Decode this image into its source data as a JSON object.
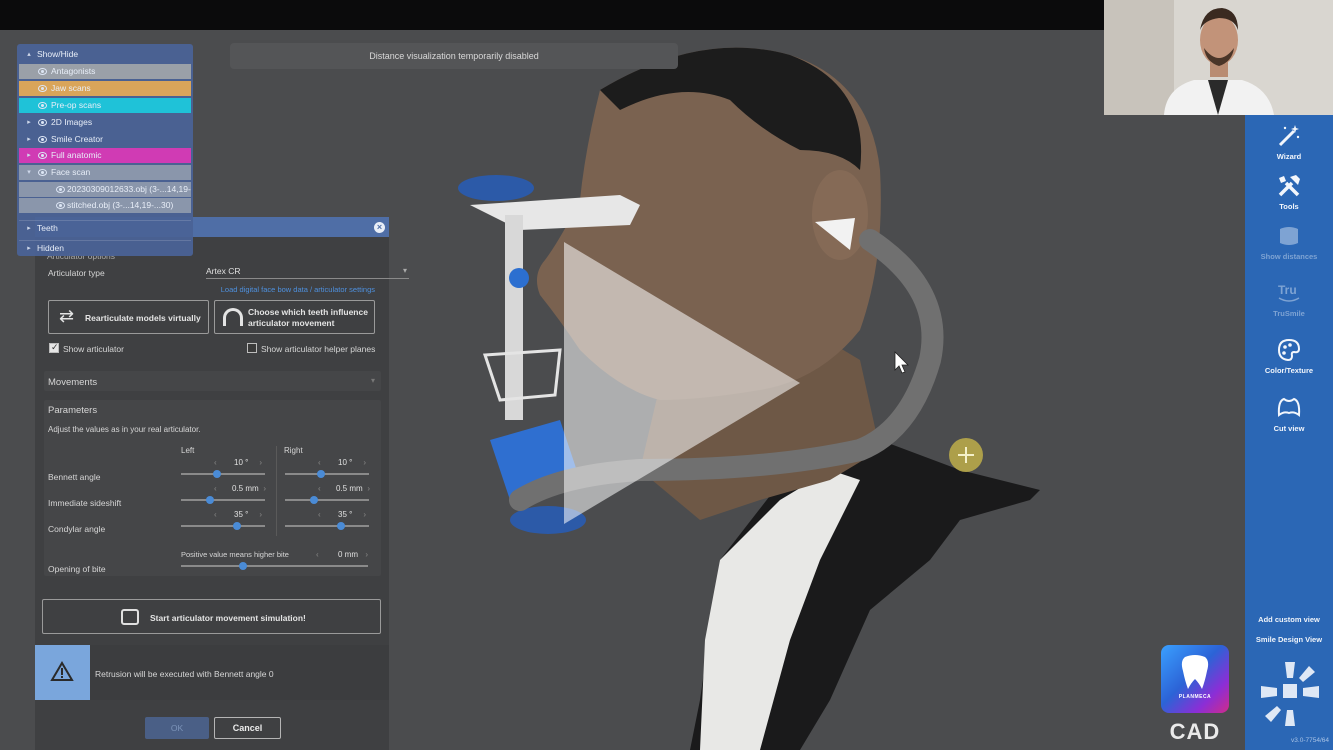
{
  "notice": "Distance visualization temporarily disabled",
  "tree": {
    "items": [
      {
        "label": "Show/Hide",
        "caret": "▴",
        "color": "",
        "eye": false
      },
      {
        "label": "Antagonists",
        "caret": "",
        "color": "#9aa0a8",
        "eye": true
      },
      {
        "label": "Jaw scans",
        "caret": "",
        "color": "#d9a55a",
        "eye": true
      },
      {
        "label": "Pre-op scans",
        "caret": "",
        "color": "#1fc2d8",
        "eye": true
      },
      {
        "label": "2D Images",
        "caret": "▸",
        "color": "",
        "eye": true
      },
      {
        "label": "Smile Creator",
        "caret": "▸",
        "color": "",
        "eye": true
      },
      {
        "label": "Full anatomic",
        "caret": "▸",
        "color": "#d03bb4",
        "eye": true
      },
      {
        "label": "Face scan",
        "caret": "▾",
        "color": "#8a96ab",
        "eye": true
      },
      {
        "label": "20230309012633.obj (3-...14,19-",
        "caret": "",
        "color": "#8a96ab",
        "eye": true
      },
      {
        "label": "stitched.obj (3-...14,19-...30)",
        "caret": "",
        "color": "#8a96ab",
        "eye": true
      },
      {
        "label": "Teeth",
        "caret": "▸",
        "color": "",
        "eye": false
      },
      {
        "label": "Hidden",
        "caret": "▸",
        "color": "",
        "eye": false
      }
    ]
  },
  "panel": {
    "section_title": "Articulator options",
    "articulator_type_label": "Articulator type",
    "articulator_type_value": "Artex CR",
    "load_link": "Load digital face bow data / articulator settings",
    "rearticulate_button": "Rearticulate models virtually",
    "choose_teeth_button": "Choose which teeth influence articulator movement",
    "show_articulator": "Show articulator",
    "show_articulator_checked": true,
    "show_helper_planes": "Show articulator helper planes",
    "show_helper_planes_checked": false,
    "movements": "Movements",
    "parameters": "Parameters",
    "adjust_hint": "Adjust the values as in your real articulator.",
    "left": "Left",
    "right": "Right",
    "bennett_angle": "Bennett angle",
    "bennett_left": "10 °",
    "bennett_right": "10 °",
    "immediate_sideshift": "Immediate sideshift",
    "sideshift_left": "0.5 mm",
    "sideshift_right": "0.5 mm",
    "condylar_angle": "Condylar angle",
    "condylar_left": "35 °",
    "condylar_right": "35 °",
    "opening_of_bite": "Opening of bite",
    "positive_hint": "Positive value means higher bite",
    "opening_value": "0 mm",
    "start_simulation": "Start articulator movement simulation!",
    "warning": "Retrusion will be executed with Bennett angle 0",
    "ok": "OK",
    "cancel": "Cancel"
  },
  "toolbar": {
    "wizard": "Wizard",
    "tools": "Tools",
    "distances": "Show distances",
    "trusmile": "TruSmile",
    "color_texture": "Color/Texture",
    "cut_view": "Cut view",
    "add_custom_view": "Add custom view",
    "smile_design_view": "Smile Design View",
    "version": "v3.0-7754/64"
  },
  "logo": {
    "brand": "PLANMECA",
    "product": "CAD"
  },
  "colors": {
    "accent": "#2b67b5",
    "panel_header": "#4f6ea6",
    "link": "#4e90de"
  }
}
